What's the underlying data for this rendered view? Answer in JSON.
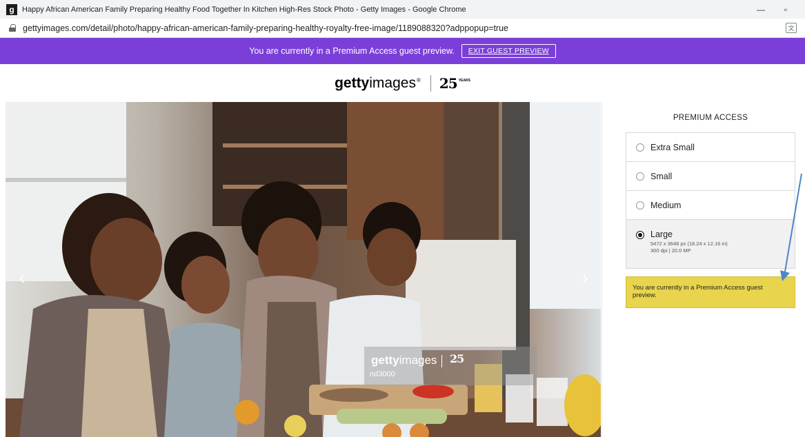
{
  "browser": {
    "favicon_letter": "g",
    "window_title": "Happy African American Family Preparing Healthy Food Together In Kitchen High-Res Stock Photo - Getty Images - Google Chrome",
    "minimize": "—",
    "restore": "▫",
    "url": "gettyimages.com/detail/photo/happy-african-american-family-preparing-healthy-royalty-free-image/1189088320?adppopup=true",
    "translate_icon": "translate-icon"
  },
  "preview_bar": {
    "message": "You are currently in a Premium Access guest preview.",
    "exit_label": "EXIT GUEST PREVIEW",
    "color": "#7b3fd9"
  },
  "logo": {
    "getty_bold": "getty",
    "getty_light": "images",
    "registered": "®",
    "anniversary": "25",
    "anniversary_sup": "YEARS"
  },
  "photo": {
    "prev_arrow": "‹",
    "next_arrow": "›",
    "watermark": {
      "getty_bold": "getty",
      "getty_light": "images",
      "anniversary": "25",
      "credit": "nd3000"
    }
  },
  "panel": {
    "title": "PREMIUM ACCESS",
    "sizes": [
      {
        "label": "Extra Small",
        "selected": false
      },
      {
        "label": "Small",
        "selected": false
      },
      {
        "label": "Medium",
        "selected": false
      },
      {
        "label": "Large",
        "selected": true,
        "detail_1": "5472 x 3648 px (18.24 x 12.16 in)",
        "detail_2": "300 dpi | 20.0 MP"
      }
    ],
    "notice": "You are currently in a Premium Access guest preview.",
    "notice_color": "#e8d44d"
  }
}
